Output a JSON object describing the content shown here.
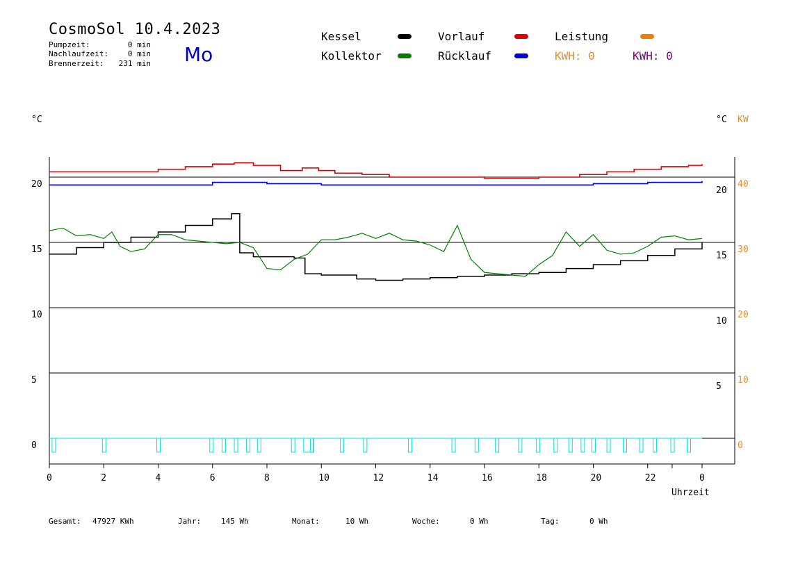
{
  "header": {
    "title": "CosmoSol 10.4.2023",
    "day": "Mo",
    "stats": [
      {
        "label": "Pumpzeit:",
        "value": "0 min"
      },
      {
        "label": "Nachlaufzeit:",
        "value": "0 min"
      },
      {
        "label": "Brennerzeit:",
        "value": "231 min"
      }
    ]
  },
  "legend": {
    "kessel": {
      "label": "Kessel",
      "color": "#000000"
    },
    "kollektor": {
      "label": "Kollektor",
      "color": "#008000"
    },
    "vorlauf": {
      "label": "Vorlauf",
      "color": "#e00000"
    },
    "ruecklauf": {
      "label": "Rücklauf",
      "color": "#0000e0"
    },
    "leistung": {
      "label": "Leistung",
      "color": "#f08000"
    },
    "kwh1": {
      "label": "KWH: 0",
      "color": "#e09030"
    },
    "kwh2": {
      "label": "KWH: 0",
      "color": "#800080"
    }
  },
  "axes": {
    "left_unit": "°C",
    "right_unit": "°C",
    "right_unit2": "KW",
    "x_label": "Uhrzeit"
  },
  "footer": {
    "gesamt": {
      "label": "Gesamt:",
      "value": "47927 KWh"
    },
    "jahr": {
      "label": "Jahr:",
      "value": "145 Wh"
    },
    "monat": {
      "label": "Monat:",
      "value": "10 Wh"
    },
    "woche": {
      "label": "Woche:",
      "value": "0 Wh"
    },
    "tag": {
      "label": "Tag:",
      "value": "0 Wh"
    }
  },
  "chart_data": {
    "type": "line",
    "xlabel": "Uhrzeit",
    "ylabel": "°C",
    "xlim": [
      0,
      24
    ],
    "ylim": [
      -2,
      22
    ],
    "x_ticks": [
      0,
      2,
      4,
      6,
      8,
      10,
      12,
      14,
      16,
      18,
      20,
      22,
      0
    ],
    "y_ticks_left": [
      0,
      5,
      10,
      15,
      20
    ],
    "y_ticks_right_temp": [
      5,
      10,
      15,
      20
    ],
    "y_ticks_right_kw": [
      0,
      10,
      20,
      30,
      40
    ],
    "grid_y": [
      0,
      5,
      10,
      15,
      20
    ],
    "series": [
      {
        "name": "Vorlauf",
        "color": "#e00000",
        "x": [
          0,
          2,
          4,
          5,
          6,
          6.8,
          7.5,
          8.5,
          9.3,
          9.9,
          10.5,
          11.5,
          12.5,
          14,
          16,
          18,
          19.5,
          20.5,
          21.5,
          22.5,
          23.5,
          24
        ],
        "y": [
          20.4,
          20.4,
          20.6,
          20.8,
          21.0,
          21.1,
          20.9,
          20.5,
          20.7,
          20.5,
          20.3,
          20.2,
          20.0,
          20.0,
          19.9,
          20.0,
          20.2,
          20.4,
          20.6,
          20.8,
          20.9,
          21.0
        ]
      },
      {
        "name": "Rücklauf",
        "color": "#0000e0",
        "x": [
          0,
          2,
          4,
          6,
          8,
          9,
          10,
          12,
          14,
          16,
          18,
          20,
          22,
          24
        ],
        "y": [
          19.4,
          19.4,
          19.4,
          19.6,
          19.5,
          19.5,
          19.4,
          19.4,
          19.4,
          19.4,
          19.4,
          19.5,
          19.6,
          19.7
        ]
      },
      {
        "name": "Kessel",
        "color": "#000000",
        "x": [
          0,
          1,
          2,
          3,
          4,
          5,
          6,
          6.7,
          7.0,
          7.5,
          8.0,
          9.0,
          9.4,
          10.0,
          11.0,
          11.3,
          12.0,
          13.0,
          14.0,
          15.0,
          16.0,
          17.0,
          18.0,
          19.0,
          20.0,
          21.0,
          22.0,
          23.0,
          24.0
        ],
        "y": [
          14.1,
          14.6,
          15.0,
          15.4,
          15.8,
          16.3,
          16.8,
          17.2,
          14.2,
          13.9,
          13.9,
          13.8,
          12.6,
          12.5,
          12.5,
          12.2,
          12.1,
          12.2,
          12.3,
          12.4,
          12.5,
          12.6,
          12.7,
          13.0,
          13.3,
          13.6,
          14.0,
          14.5,
          15.0
        ]
      },
      {
        "name": "Kollektor",
        "color": "#008000",
        "x": [
          0,
          0.5,
          1,
          1.5,
          2.0,
          2.3,
          2.6,
          3.0,
          3.5,
          4.0,
          4.5,
          5.0,
          5.5,
          6.0,
          6.5,
          7.0,
          7.5,
          8.0,
          8.5,
          9.0,
          9.5,
          10.0,
          10.5,
          11.0,
          11.5,
          12.0,
          12.5,
          13.0,
          13.5,
          14.0,
          14.5,
          15.0,
          15.5,
          16.0,
          16.5,
          17.0,
          17.5,
          18.0,
          18.5,
          19.0,
          19.5,
          20.0,
          20.5,
          21.0,
          21.5,
          22.0,
          22.5,
          23.0,
          23.5,
          24.0
        ],
        "y": [
          15.9,
          16.1,
          15.5,
          15.6,
          15.3,
          15.8,
          14.7,
          14.3,
          14.5,
          15.6,
          15.6,
          15.2,
          15.1,
          15.0,
          14.9,
          15.0,
          14.6,
          13.0,
          12.9,
          13.7,
          14.1,
          15.2,
          15.2,
          15.4,
          15.7,
          15.3,
          15.7,
          15.2,
          15.1,
          14.8,
          14.3,
          16.3,
          13.7,
          12.7,
          12.6,
          12.5,
          12.4,
          13.3,
          14.0,
          15.8,
          14.7,
          15.6,
          14.4,
          14.1,
          14.2,
          14.7,
          15.4,
          15.5,
          15.2,
          15.3
        ]
      },
      {
        "name": "Leistung",
        "color": "#00e0e0",
        "x": [
          0,
          2,
          4,
          6,
          8,
          10,
          12,
          14,
          16,
          18,
          20,
          22,
          24
        ],
        "y": [
          0,
          0,
          0,
          0,
          0,
          0,
          0,
          0,
          0,
          0,
          0,
          0,
          0
        ]
      }
    ],
    "pulses_x": [
      0.1,
      1.95,
      3.95,
      5.9,
      6.35,
      6.8,
      7.25,
      7.65,
      8.9,
      9.35,
      9.6,
      10.7,
      11.55,
      13.2,
      14.8,
      15.65,
      16.4,
      17.25,
      17.9,
      18.55,
      19.1,
      19.55,
      19.95,
      20.5,
      21.1,
      21.7,
      22.2,
      22.85,
      23.45
    ]
  }
}
